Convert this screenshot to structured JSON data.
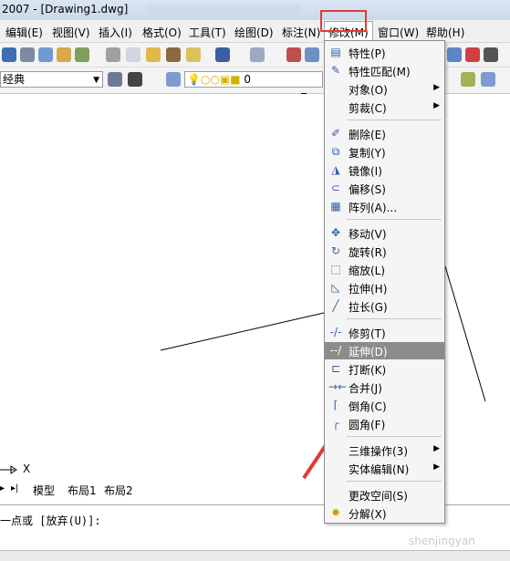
{
  "window": {
    "title": "2007 - [Drawing1.dwg]"
  },
  "menubar": {
    "items": [
      "编辑(E)",
      "视图(V)",
      "插入(I)",
      "格式(O)",
      "工具(T)",
      "绘图(D)",
      "标注(N)",
      "修改(M)",
      "窗口(W)",
      "帮助(H)"
    ]
  },
  "toolbar": {
    "workspace_value": "经典",
    "layer_value": "0"
  },
  "modify_menu": {
    "items": [
      {
        "label": "特性(P)",
        "icon": "properties-icon"
      },
      {
        "label": "特性匹配(M)",
        "icon": "match-properties-icon"
      },
      {
        "label": "对象(O)",
        "icon": "",
        "submenu": true
      },
      {
        "label": "剪裁(C)",
        "icon": "",
        "submenu": true
      },
      {
        "label": "删除(E)",
        "icon": "erase-icon"
      },
      {
        "label": "复制(Y)",
        "icon": "copy-icon"
      },
      {
        "label": "镜像(I)",
        "icon": "mirror-icon"
      },
      {
        "label": "偏移(S)",
        "icon": "offset-icon"
      },
      {
        "label": "阵列(A)...",
        "icon": "array-icon"
      },
      {
        "label": "移动(V)",
        "icon": "move-icon"
      },
      {
        "label": "旋转(R)",
        "icon": "rotate-icon"
      },
      {
        "label": "缩放(L)",
        "icon": "scale-icon"
      },
      {
        "label": "拉伸(H)",
        "icon": "stretch-icon"
      },
      {
        "label": "拉长(G)",
        "icon": "lengthen-icon"
      },
      {
        "label": "修剪(T)",
        "icon": "trim-icon"
      },
      {
        "label": "延伸(D)",
        "icon": "extend-icon",
        "highlighted": true
      },
      {
        "label": "打断(K)",
        "icon": "break-icon"
      },
      {
        "label": "合并(J)",
        "icon": "join-icon"
      },
      {
        "label": "倒角(C)",
        "icon": "chamfer-icon"
      },
      {
        "label": "圆角(F)",
        "icon": "fillet-icon"
      },
      {
        "label": "三维操作(3)",
        "icon": "",
        "submenu": true
      },
      {
        "label": "实体编辑(N)",
        "icon": "",
        "submenu": true
      },
      {
        "label": "更改空间(S)",
        "icon": ""
      },
      {
        "label": "分解(X)",
        "icon": "explode-icon"
      }
    ]
  },
  "layout_tabs": [
    "模型",
    "布局1",
    "布局2"
  ],
  "ucs": {
    "x_label": "X"
  },
  "command": {
    "prompt": "一点或 [放弃(U)]:"
  },
  "watermark": "shenjingyan",
  "colors": {
    "highlight_box": "#e53935",
    "arrow": "#e53935",
    "menu_highlight": "#8c8c8c"
  }
}
